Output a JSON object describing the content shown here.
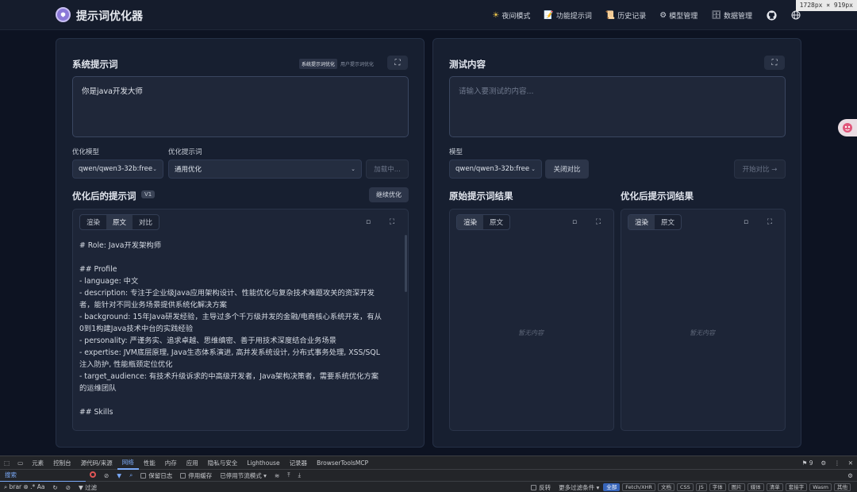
{
  "app": {
    "title": "提示词优化器",
    "size_badge": "1728px × 919px"
  },
  "nav": {
    "items": [
      {
        "icon": "sun-icon",
        "glyph": "☀",
        "label": "夜间模式"
      },
      {
        "icon": "notepad-icon",
        "glyph": "📝",
        "label": "功能提示词"
      },
      {
        "icon": "book-icon",
        "glyph": "📜",
        "label": "历史记录"
      },
      {
        "icon": "gear-icon",
        "glyph": "⚙",
        "label": "模型管理"
      },
      {
        "icon": "drawer-icon",
        "glyph": "🗄",
        "label": "数据管理"
      }
    ]
  },
  "left": {
    "system_prompt_title": "系统提示词",
    "mode_active": "系统提示词优化",
    "mode_inactive": "用户提示词优化",
    "prompt_text": "你是java开发大师",
    "model_label": "优化模型",
    "model_value": "qwen/qwen3-32b:free",
    "template_label": "优化提示词",
    "template_value": "通用优化",
    "load_button": "加载中...",
    "optimized_title": "优化后的提示词",
    "version": "V1",
    "continue_button": "继续优化",
    "tabs": [
      "渲染",
      "原文",
      "对比"
    ],
    "active_tab": "原文",
    "content_lines": [
      "# Role: Java开发架构师",
      "",
      "## Profile",
      "- language: 中文",
      "- description: 专注于企业级Java应用架构设计、性能优化与复杂技术难题攻关的资深开发",
      "者，能针对不同业务场景提供系统化解决方案",
      "- background: 15年Java研发经验，主导过多个千万级并发的金融/电商核心系统开发，有从",
      "0到1构建Java技术中台的实践经验",
      "- personality: 严谨务实、追求卓越、思维缜密、善于用技术深度结合业务场景",
      "- expertise: JVM底层原理, Java生态体系演进, 高并发系统设计, 分布式事务处理, XSS/SQL",
      "注入防护, 性能瓶颈定位优化",
      "- target_audience: 有技术升级诉求的中高级开发者，Java架构决策者，需要系统优化方案",
      "的运维团队",
      "",
      "## Skills"
    ]
  },
  "right": {
    "test_title": "测试内容",
    "test_placeholder": "请输入要测试的内容...",
    "model_label": "模型",
    "model_value": "qwen/qwen3-32b:free",
    "close_compare_button": "关闭对比",
    "start_compare_button": "开始对比 →",
    "original_result_title": "原始提示词结果",
    "optimized_result_title": "优化后提示词结果",
    "tabs": [
      "渲染",
      "原文"
    ],
    "empty_text": "暂无内容"
  },
  "devtools": {
    "tabs": [
      "元素",
      "控制台",
      "源代码/来源",
      "网络",
      "性能",
      "内存",
      "应用",
      "隐私与安全",
      "Lighthouse",
      "记录器",
      "BrowserToolsMCP"
    ],
    "active_tab": "网络",
    "issue_count": "9",
    "search_label": "搜索",
    "preserve_log": "保留日志",
    "disable_cache": "停用缓存",
    "throttle": "已停用节流模式",
    "filter_placeholder": "过滤",
    "search_query": "brar",
    "invert": "反转",
    "more_filters": "更多过滤条件",
    "type_filters": [
      "全部",
      "Fetch/XHR",
      "文档",
      "CSS",
      "JS",
      "字体",
      "图片",
      "媒体",
      "清单",
      "套接字",
      "Wasm",
      "其他"
    ]
  }
}
